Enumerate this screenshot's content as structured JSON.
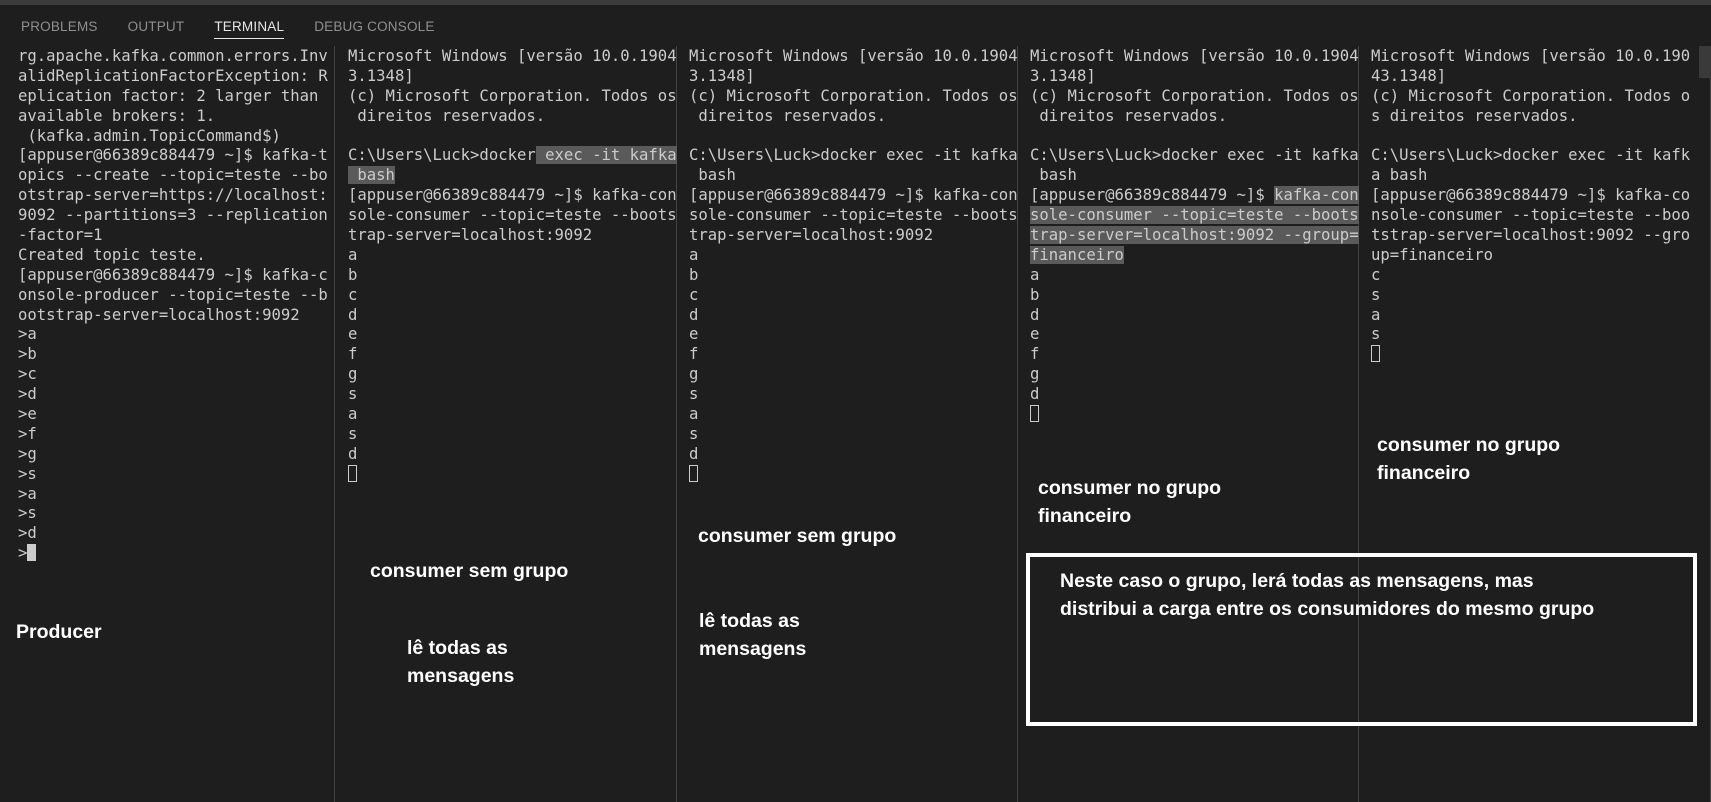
{
  "panel_tabs": [
    {
      "label": "PROBLEMS",
      "active": false
    },
    {
      "label": "OUTPUT",
      "active": false
    },
    {
      "label": "TERMINAL",
      "active": true
    },
    {
      "label": "DEBUG CONSOLE",
      "active": false
    }
  ],
  "terminals": [
    {
      "lines": [
        "rg.apache.kafka.common.errors.Inv",
        "alidReplicationFactorException: R",
        "eplication factor: 2 larger than",
        "available brokers: 1.",
        " (kafka.admin.TopicCommand$)",
        "[appuser@66389c884479 ~]$ kafka-t",
        "opics --create --topic=teste --bo",
        "otstrap-server=https://localhost:",
        "9092 --partitions=3 --replication",
        "-factor=1",
        "Created topic teste.",
        "[appuser@66389c884479 ~]$ kafka-c",
        "onsole-producer --topic=teste --b",
        "ootstrap-server=localhost:9092",
        ">a",
        ">b",
        ">c",
        ">d",
        ">e",
        ">f",
        ">g",
        ">s",
        ">a",
        ">s",
        ">d",
        ">"
      ]
    },
    {
      "lines": [
        "Microsoft Windows [versão 10.0.1904",
        "3.1348]",
        "(c) Microsoft Corporation. Todos os",
        " direitos reservados.",
        "",
        "C:\\Users\\Luck>docker exec -it kafka",
        " bash",
        "[appuser@66389c884479 ~]$ kafka-con",
        "sole-consumer --topic=teste --boots",
        "trap-server=localhost:9092",
        "a",
        "b",
        "c",
        "d",
        "e",
        "f",
        "g",
        "s",
        "a",
        "s",
        "d",
        ""
      ]
    },
    {
      "lines": [
        "Microsoft Windows [versão 10.0.1904",
        "3.1348]",
        "(c) Microsoft Corporation. Todos os",
        " direitos reservados.",
        "",
        "C:\\Users\\Luck>docker exec -it kafka",
        " bash",
        "[appuser@66389c884479 ~]$ kafka-con",
        "sole-consumer --topic=teste --boots",
        "trap-server=localhost:9092",
        "a",
        "b",
        "c",
        "d",
        "e",
        "f",
        "g",
        "s",
        "a",
        "s",
        "d",
        ""
      ]
    },
    {
      "lines": [
        "Microsoft Windows [versão 10.0.1904",
        "3.1348]",
        "(c) Microsoft Corporation. Todos os",
        " direitos reservados.",
        "",
        "C:\\Users\\Luck>docker exec -it kafka",
        " bash",
        "[appuser@66389c884479 ~]$ kafka-con",
        "sole-consumer --topic=teste --boots",
        "trap-server=localhost:9092 --group=",
        "financeiro",
        "a",
        "b",
        "d",
        "e",
        "f",
        "g",
        "d",
        ""
      ]
    },
    {
      "lines": [
        "Microsoft Windows [versão 10.0.190",
        "43.1348]",
        "(c) Microsoft Corporation. Todos o",
        "s direitos reservados.",
        "",
        "C:\\Users\\Luck>docker exec -it kafk",
        "a bash",
        "[appuser@66389c884479 ~]$ kafka-co",
        "nsole-consumer --topic=teste --boo",
        "tstrap-server=localhost:9092 --gro",
        "up=financeiro",
        "c",
        "s",
        "a",
        "s",
        ""
      ]
    }
  ],
  "annotations": {
    "producer": "Producer",
    "consumer_sem_grupo_1": "consumer sem grupo",
    "le_todas_1": "lê todas as\nmensagens",
    "consumer_sem_grupo_2": "consumer sem grupo",
    "le_todas_2": "lê todas as\nmensagens",
    "consumer_grupo_1": "consumer no grupo\nfinanceiro",
    "consumer_grupo_2": "consumer no grupo\nfinanceiro",
    "box_note": "Neste caso o grupo, lerá todas as mensagens, mas\ndistribui a carga entre os consumidores do mesmo grupo"
  }
}
